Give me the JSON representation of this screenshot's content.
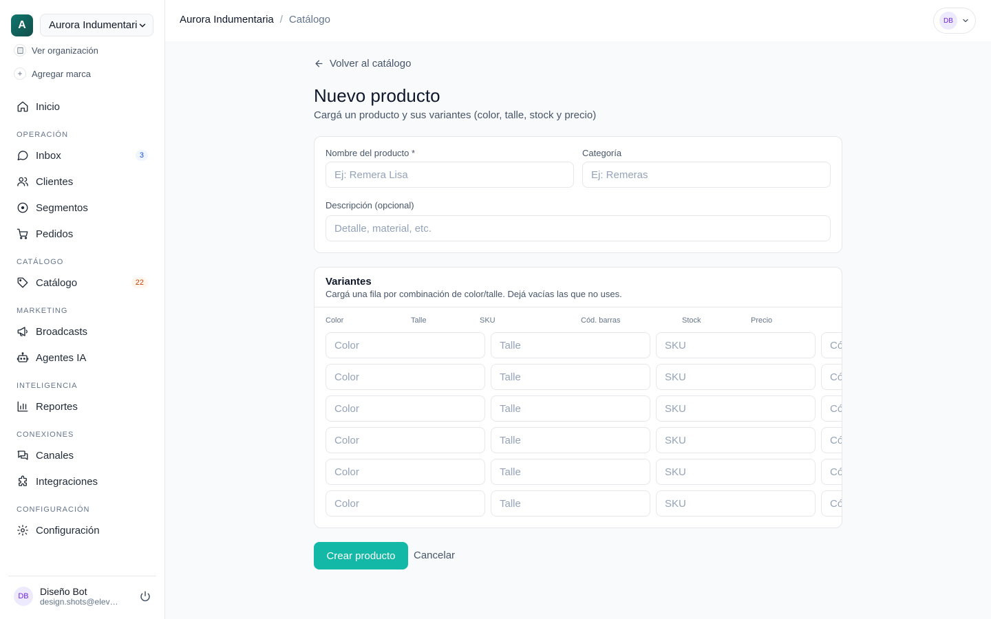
{
  "org": {
    "logo_letter": "A",
    "name": "Aurora Indumentaria",
    "view_org": "Ver organización",
    "add_brand": "Agregar marca"
  },
  "nav": {
    "home": "Inicio",
    "sections": {
      "operation": "OPERACIÓN",
      "catalog": "CATÁLOGO",
      "marketing": "MARKETING",
      "intelligence": "INTELIGENCIA",
      "connections": "CONEXIONES",
      "settings": "CONFIGURACIÓN"
    },
    "items": {
      "inbox": "Inbox",
      "inbox_badge": "3",
      "clients": "Clientes",
      "segments": "Segmentos",
      "orders": "Pedidos",
      "catalog": "Catálogo",
      "catalog_badge": "22",
      "broadcasts": "Broadcasts",
      "agents": "Agentes IA",
      "reports": "Reportes",
      "channels": "Canales",
      "integrations": "Integraciones",
      "configuration": "Configuración"
    }
  },
  "user": {
    "initials": "DB",
    "name": "Diseño Bot",
    "email": "design.shots@eleventa.ai"
  },
  "header": {
    "breadcrumb": [
      "Aurora Indumentaria",
      "/",
      "Catálogo"
    ],
    "account_initials": "DB"
  },
  "page": {
    "back": "Volver al catálogo",
    "title": "Nuevo producto",
    "subtitle": "Cargá un producto y sus variantes (color, talle, stock y precio)"
  },
  "form": {
    "name_label": "Nombre del producto *",
    "name_placeholder": "Ej: Remera Lisa",
    "category_label": "Categoría",
    "category_placeholder": "Ej: Remeras",
    "description_label": "Descripción (opcional)",
    "description_placeholder": "Detalle, material, etc."
  },
  "variants": {
    "title": "Variantes",
    "subtitle": "Cargá una fila por combinación de color/talle. Dejá vacías las que no uses.",
    "columns": [
      "Color",
      "Talle",
      "SKU",
      "Cód. barras",
      "Stock",
      "Precio"
    ],
    "placeholders": {
      "color": "Color",
      "size": "Talle",
      "sku": "SKU",
      "barcode": "Cód. barras"
    },
    "row_count": 6
  },
  "actions": {
    "create": "Crear producto",
    "cancel": "Cancelar"
  },
  "colors": {
    "accent": "#14b8a6",
    "org_logo": "#0f766e"
  }
}
